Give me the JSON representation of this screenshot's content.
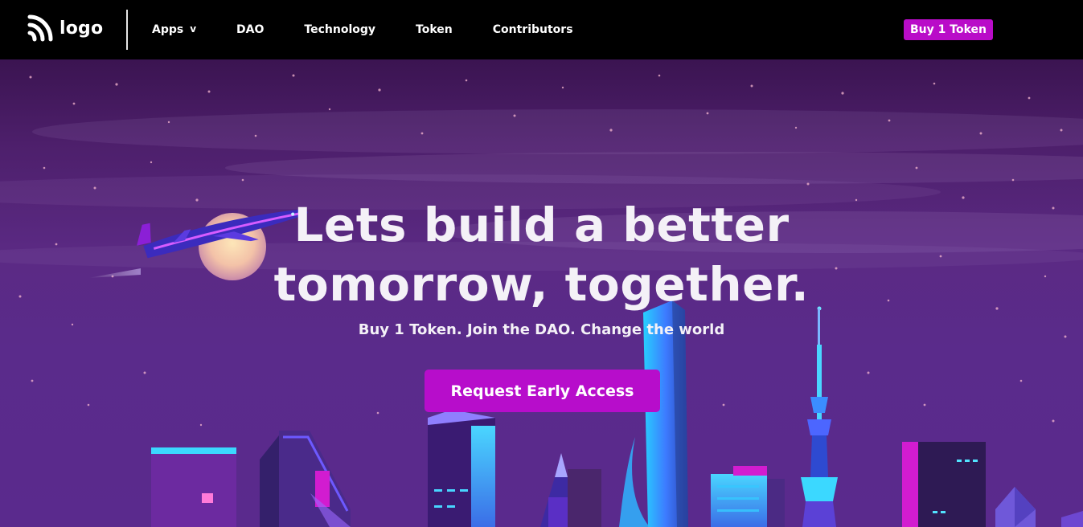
{
  "header": {
    "logo_text": "logo",
    "nav": [
      {
        "label": "Apps",
        "has_dropdown": true
      },
      {
        "label": "DAO"
      },
      {
        "label": "Technology"
      },
      {
        "label": "Token"
      },
      {
        "label": "Contributors"
      }
    ],
    "buy_button_label": "Buy 1 Token",
    "dropdown_glyph": "v"
  },
  "hero": {
    "title_line1": "Lets build a better",
    "title_line2": "tomorrow, together.",
    "subtitle": "Buy 1 Token. Join the DAO. Change the world",
    "cta_label": "Request Early Access"
  },
  "colors": {
    "accent": "#b90cc8",
    "header_bg": "#000000",
    "hero_top": "#3b1451",
    "hero_bottom": "#5a2a8d"
  },
  "icons": {
    "logo_icon": "rss-style-logo-icon",
    "dropdown_icon": "chevron-down-icon"
  }
}
